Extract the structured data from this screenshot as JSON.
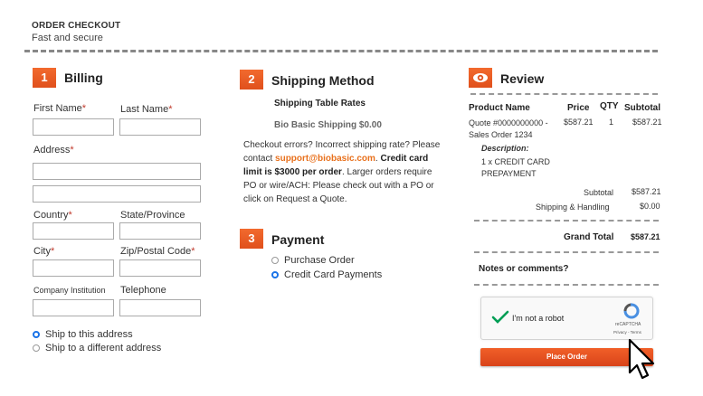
{
  "header": {
    "title": "ORDER CHECKOUT",
    "subtitle": "Fast and secure"
  },
  "billing": {
    "step": "1",
    "title": "Billing",
    "first_name_label": "First Name",
    "last_name_label": "Last Name",
    "address_label": "Address",
    "country_label": "Country",
    "state_label": "State/Province",
    "city_label": "City",
    "zip_label": "Zip/Postal Code",
    "company_label": "Company Institution",
    "phone_label": "Telephone",
    "required_mark": "*",
    "ship_options": [
      {
        "label": "Ship to this address",
        "selected": true
      },
      {
        "label": "Ship to a different address",
        "selected": false
      }
    ]
  },
  "shipping": {
    "step": "2",
    "title": "Shipping Method",
    "rates_heading": "Shipping Table Rates",
    "method": "Bio Basic Shipping $0.00",
    "note_line1": "Checkout errors? Incorrect shipping rate? Please",
    "note_contact": "contact ",
    "note_email": "support@biobasic.com",
    "note_dot": ". ",
    "note_bold1": "Credit card",
    "note_bold2": "limit is $3000 per order",
    "note_rest1": ". Larger orders require",
    "note_line4": "PO or wire/ACH: Please check out with a PO or",
    "note_line5": "click on Request a Quote."
  },
  "payment": {
    "step": "3",
    "title": "Payment",
    "options": [
      {
        "label": "Purchase Order",
        "selected": false
      },
      {
        "label": "Credit Card Payments",
        "selected": true
      }
    ]
  },
  "review": {
    "title": "Review",
    "icon": "eye-icon",
    "columns": [
      "Product Name",
      "Price",
      "QTY",
      "Subtotal"
    ],
    "item": {
      "name_line1": "Quote #0000000000 -",
      "name_line2": "Sales Order 1234",
      "price": "$587.21",
      "qty": "1",
      "subtotal": "$587.21",
      "description_label": "Description:",
      "description_line1": "1 x CREDIT CARD",
      "description_line2": "PREPAYMENT"
    },
    "subtotal_label": "Subtotal",
    "subtotal_value": "$587.21",
    "shipping_label": "Shipping & Handling",
    "shipping_value": "$0.00",
    "grand_total_label": "Grand Total",
    "grand_total_value": "$587.21",
    "comments_label": "Notes or comments?"
  },
  "captcha": {
    "label": "I'm not a robot",
    "brand": "reCAPTCHA",
    "links": "Privacy - Terms"
  },
  "place_order": "Place Order",
  "colors": {
    "accent": "#e8581f",
    "link": "#e8701c",
    "radio_selected": "#1a73e8",
    "check": "#009e55"
  }
}
